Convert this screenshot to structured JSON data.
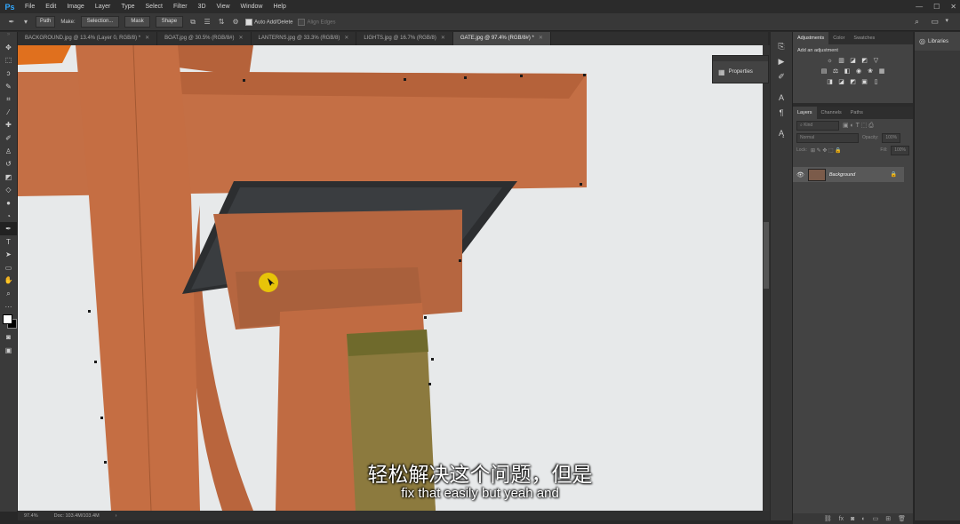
{
  "app": {
    "logo": "Ps"
  },
  "menu": [
    "File",
    "Edit",
    "Image",
    "Layer",
    "Type",
    "Select",
    "Filter",
    "3D",
    "View",
    "Window",
    "Help"
  ],
  "window_controls": [
    "—",
    "☐",
    "✕"
  ],
  "options": {
    "mode": "Path",
    "make_label": "Make:",
    "selection": "Selection...",
    "mask": "Mask",
    "shape": "Shape",
    "auto_add_delete": "Auto Add/Delete",
    "align_edges": "Align Edges"
  },
  "tabs": [
    {
      "label": "BACKGROUND.jpg @ 13.4% (Layer 0, RGB/8) *"
    },
    {
      "label": "BOAT.jpg @ 30.5% (RGB/8#)"
    },
    {
      "label": "LANTERNS.jpg @ 33.3% (RGB/8)"
    },
    {
      "label": "LIGHTS.jpg @ 16.7% (RGB/8)"
    },
    {
      "label": "GATE.jpg @ 97.4% (RGB/8#) *"
    }
  ],
  "tab_close": "✕",
  "status": {
    "zoom": "97.4%",
    "doc": "Doc: 103.4M/103.4M",
    "arrow": "›"
  },
  "properties": {
    "label": "Properties"
  },
  "panels": {
    "top_tabs": [
      "Adjustments",
      "Color",
      "Swatches"
    ],
    "add_adjustment": "Add an adjustment",
    "layer_tabs": [
      "Layers",
      "Channels",
      "Paths"
    ],
    "kind": "Kind",
    "blend_mode": "Normal",
    "opacity_label": "Opacity:",
    "opacity_value": "100%",
    "lock_label": "Lock:",
    "fill_label": "Fill:",
    "fill_value": "100%",
    "layer_name": "Background"
  },
  "libraries": {
    "label": "Libraries"
  },
  "subtitles": {
    "cn": "轻松解决这个问题，但是",
    "en": "fix that easily but yeah and"
  },
  "colors": {
    "accent": "#31a8ff",
    "pillar": "#c46f45",
    "sky": "#e7e9ea"
  }
}
